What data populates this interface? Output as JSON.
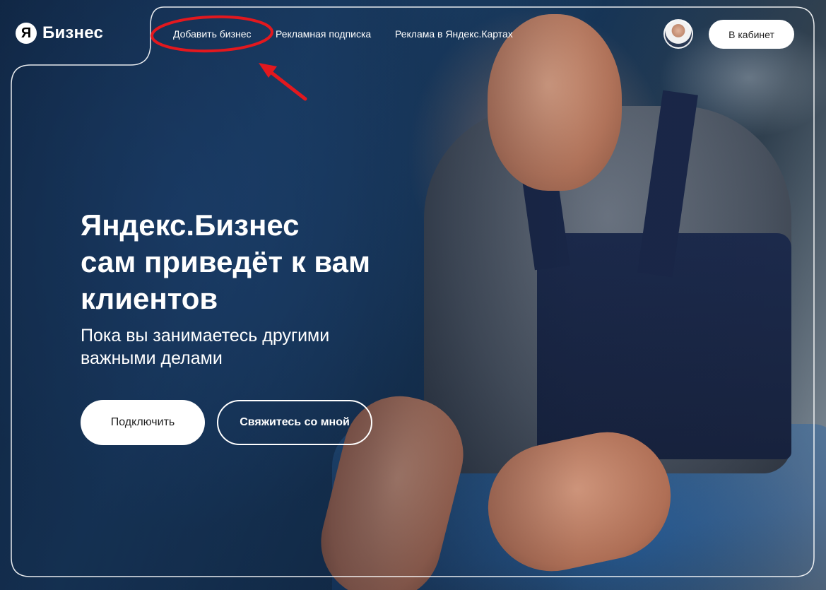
{
  "brand": {
    "logo_letter": "Я",
    "name": "Бизнес"
  },
  "nav": {
    "items": [
      "Добавить бизнес",
      "Рекламная подписка",
      "Реклама в Яндекс.Картах"
    ]
  },
  "header": {
    "cabinet_label": "В кабинет"
  },
  "hero": {
    "title_lines": [
      "Яндекс.Бизнес",
      "сам приведёт к вам",
      "клиентов"
    ],
    "subtitle_lines": [
      "Пока вы занимаетесь другими",
      "важными делами"
    ],
    "connect_label": "Подключить",
    "contact_label": "Свяжитесь со мной"
  },
  "colors": {
    "annotation": "#e3181e",
    "button_bg": "#ffffff",
    "text": "#ffffff"
  },
  "icons": {
    "avatar": "user-avatar",
    "annotation_arrow": "red-arrow-icon"
  }
}
